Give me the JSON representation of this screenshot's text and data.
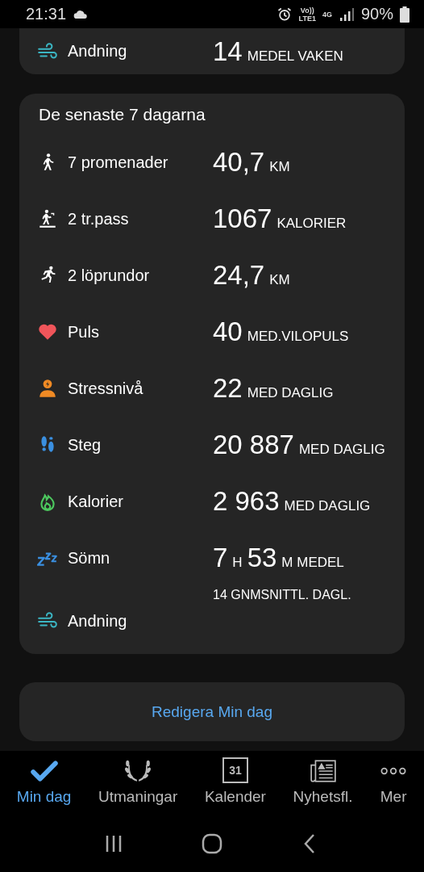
{
  "status_bar": {
    "time": "21:31",
    "network_top": "Vo))",
    "network_bottom": "LTE1",
    "network_type": "4G",
    "battery": "90%"
  },
  "top_card": {
    "kind": "wind",
    "label": "Andning",
    "value": [
      {
        "text": "14",
        "kind": "big"
      },
      {
        "text": "MEDEL VAKEN",
        "kind": "unit"
      }
    ]
  },
  "summary_card": {
    "title": "De senaste 7 dagarna",
    "rows": [
      {
        "kind": "walk",
        "label": "7 promenader",
        "value": [
          {
            "text": "40,7",
            "kind": "big"
          },
          {
            "text": "KM",
            "kind": "unit"
          }
        ]
      },
      {
        "kind": "treadmill",
        "label": "2 tr.pass",
        "value": [
          {
            "text": "1067",
            "kind": "big"
          },
          {
            "text": "KALORIER",
            "kind": "unit"
          }
        ]
      },
      {
        "kind": "run",
        "label": "2 löprundor",
        "value": [
          {
            "text": "24,7",
            "kind": "big"
          },
          {
            "text": "KM",
            "kind": "unit"
          }
        ]
      },
      {
        "kind": "heart",
        "label": "Puls",
        "value": [
          {
            "text": "40",
            "kind": "big"
          },
          {
            "text": "MED.VILOPULS",
            "kind": "unit"
          }
        ]
      },
      {
        "kind": "stress",
        "label": "Stressnivå",
        "value": [
          {
            "text": "22",
            "kind": "big"
          },
          {
            "text": "MED DAGLIG",
            "kind": "unit"
          }
        ]
      },
      {
        "kind": "steps",
        "label": "Steg",
        "value": [
          {
            "text": "20 887",
            "kind": "big"
          },
          {
            "text": "MED DAGLIG",
            "kind": "unit"
          }
        ]
      },
      {
        "kind": "flame",
        "label": "Kalorier",
        "value": [
          {
            "text": "2 963",
            "kind": "big"
          },
          {
            "text": "MED DAGLIG",
            "kind": "unit"
          }
        ]
      },
      {
        "kind": "sleep",
        "label": "Sömn",
        "value": [
          {
            "text": "7",
            "kind": "big"
          },
          {
            "text": "H",
            "kind": "unit"
          },
          {
            "text": "53",
            "kind": "big"
          },
          {
            "text": "M MEDEL",
            "kind": "unit"
          }
        ]
      },
      {
        "kind": "wind",
        "label": "Andning",
        "value": [
          {
            "text": "14 GNMSNITTL. DAGL.",
            "kind": "note"
          }
        ]
      }
    ]
  },
  "edit_button": "Redigera Min dag",
  "bottom_nav": [
    {
      "label": "Min dag",
      "kind": "check",
      "selected": true
    },
    {
      "label": "Utmaningar",
      "kind": "laurel",
      "selected": false
    },
    {
      "label": "Kalender",
      "kind": "calendar",
      "icon_text": "31",
      "selected": false
    },
    {
      "label": "Nyhetsfl.",
      "kind": "news",
      "selected": false
    },
    {
      "label": "Mer",
      "kind": "more",
      "selected": false
    }
  ]
}
